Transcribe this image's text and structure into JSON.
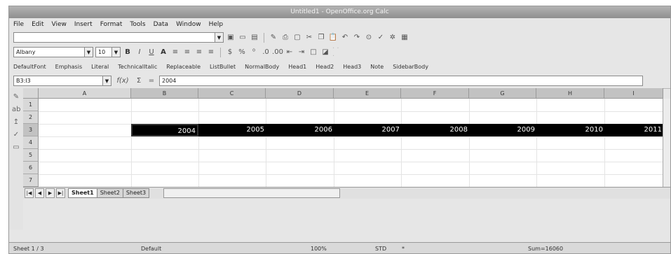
{
  "window": {
    "title": "Untitled1 - OpenOffice.org Calc"
  },
  "menu": [
    "File",
    "Edit",
    "View",
    "Insert",
    "Format",
    "Tools",
    "Data",
    "Window",
    "Help"
  ],
  "toolbar": {
    "font_name": "Albany",
    "font_size": "10"
  },
  "styles": [
    "DefaultFont",
    "Emphasis",
    "Literal",
    "TechnicalItalic",
    "Replaceable",
    "ListBullet",
    "NormalBody",
    "Head1",
    "Head2",
    "Head3",
    "Note",
    "SidebarBody"
  ],
  "formula": {
    "cell_ref": "B3:I3",
    "func_label": "f(x)",
    "sum_label": "Σ",
    "eq_label": "=",
    "value": "2004"
  },
  "columns": [
    "A",
    "B",
    "C",
    "D",
    "E",
    "F",
    "G",
    "H",
    "I"
  ],
  "rows": [
    "1",
    "2",
    "3",
    "4",
    "5",
    "6",
    "7"
  ],
  "row3_values": [
    "2004",
    "2005",
    "2006",
    "2007",
    "2008",
    "2009",
    "2010",
    "2011"
  ],
  "tabs": [
    "Sheet1",
    "Sheet2",
    "Sheet3"
  ],
  "status": {
    "sheet": "Sheet 1 / 3",
    "page_style": "Default",
    "zoom": "100%",
    "mode": "STD",
    "star": "*",
    "sum": "Sum=16060"
  }
}
